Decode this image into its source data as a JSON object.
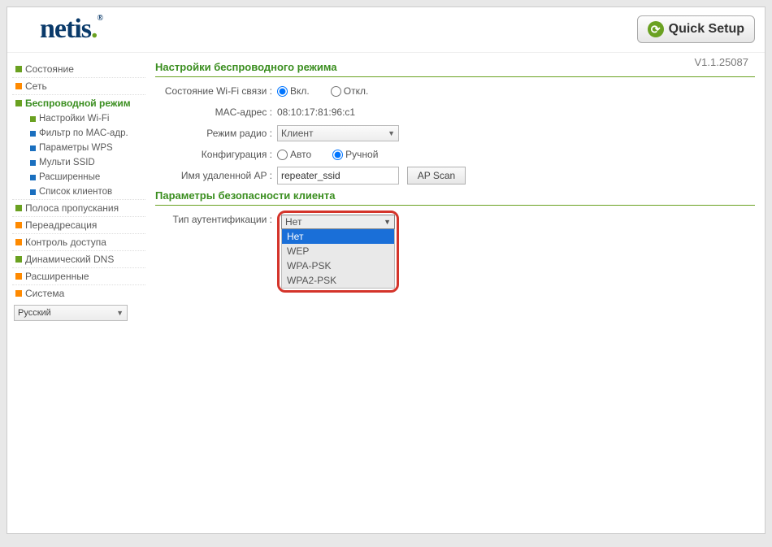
{
  "header": {
    "logo_text": "netis",
    "quick_setup_label": "Quick Setup",
    "version": "V1.1.25087"
  },
  "sidebar": {
    "items": [
      {
        "label": "Состояние"
      },
      {
        "label": "Сеть"
      },
      {
        "label": "Беспроводной режим",
        "active": true
      },
      {
        "label": "Полоса пропускания"
      },
      {
        "label": "Переадресация"
      },
      {
        "label": "Контроль доступа"
      },
      {
        "label": "Динамический DNS"
      },
      {
        "label": "Расширенные"
      },
      {
        "label": "Система"
      }
    ],
    "wireless_sub": [
      {
        "label": "Настройки Wi-Fi"
      },
      {
        "label": "Фильтр по MAC-адр."
      },
      {
        "label": "Параметры WPS"
      },
      {
        "label": "Мульти SSID"
      },
      {
        "label": "Расширенные"
      },
      {
        "label": "Список клиентов"
      }
    ],
    "language": "Русский"
  },
  "content": {
    "section1_title": "Настройки беспроводного режима",
    "wifi_state_label": "Состояние Wi-Fi связи :",
    "wifi_on": "Вкл.",
    "wifi_off": "Откл.",
    "mac_label": "MAC-адрес :",
    "mac_value": "08:10:17:81:96:c1",
    "radio_mode_label": "Режим радио :",
    "radio_mode_value": "Клиент",
    "config_label": "Конфигурация :",
    "config_auto": "Авто",
    "config_manual": "Ручной",
    "remote_ap_label": "Имя удаленной AP :",
    "remote_ap_value": "repeater_ssid",
    "ap_scan_label": "AP Scan",
    "section2_title": "Параметры безопасности клиента",
    "auth_type_label": "Тип аутентификации :",
    "auth_selected": "Нет",
    "auth_options": [
      "Нет",
      "WEP",
      "WPA-PSK",
      "WPA2-PSK"
    ]
  }
}
